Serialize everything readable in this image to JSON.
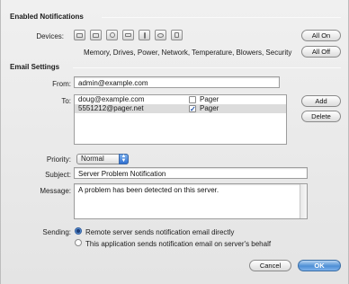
{
  "notifications": {
    "title": "Enabled Notifications",
    "devices_label": "Devices:",
    "device_icons": [
      "memory-icon",
      "drive-icon",
      "power-icon",
      "network-icon",
      "temperature-icon",
      "blower-icon",
      "security-icon"
    ],
    "description": "Memory, Drives, Power, Network, Temperature, Blowers, Security",
    "all_on": "All On",
    "all_off": "All Off"
  },
  "email": {
    "title": "Email Settings",
    "from_label": "From:",
    "from_value": "admin@example.com",
    "to_label": "To:",
    "recipients": [
      {
        "address": "doug@example.com",
        "pager_label": "Pager",
        "pager": false
      },
      {
        "address": "5551212@pager.net",
        "pager_label": "Pager",
        "pager": true
      }
    ],
    "add": "Add",
    "delete": "Delete",
    "priority_label": "Priority:",
    "priority_value": "Normal",
    "subject_label": "Subject:",
    "subject_value": "Server Problem Notification",
    "message_label": "Message:",
    "message_value": "A problem has been detected on this server.",
    "sending_label": "Sending:",
    "sending_options": [
      {
        "label": "Remote server sends notification email directly",
        "selected": true
      },
      {
        "label": "This application sends notification email on server's behalf",
        "selected": false
      }
    ]
  },
  "footer": {
    "cancel": "Cancel",
    "ok": "OK"
  }
}
